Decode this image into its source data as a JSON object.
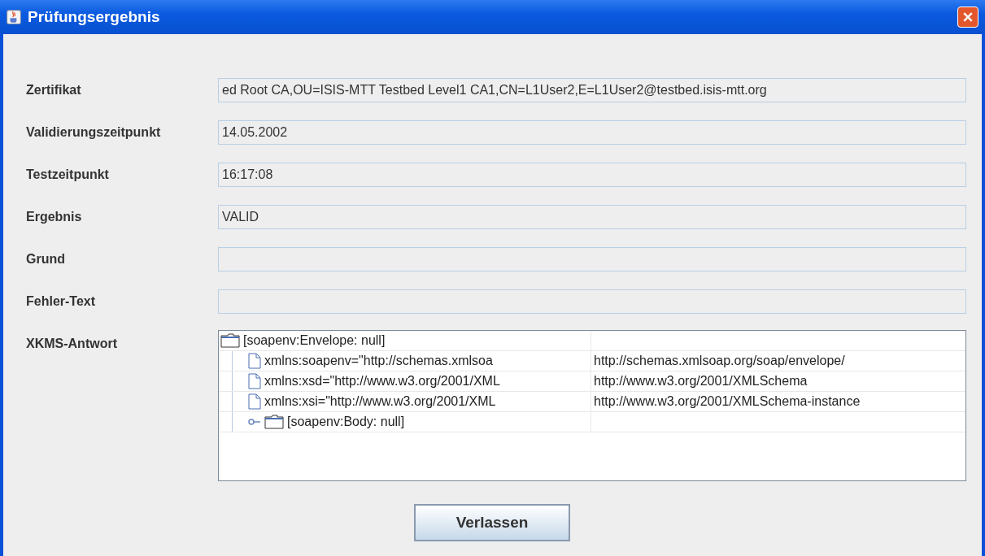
{
  "window": {
    "title": "Prüfungsergebnis"
  },
  "fields": [
    {
      "label": "Zertifikat",
      "value": "ed Root CA,OU=ISIS-MTT Testbed Level1 CA1,CN=L1User2,E=L1User2@testbed.isis-mtt.org"
    },
    {
      "label": "Validierungszeitpunkt",
      "value": "14.05.2002"
    },
    {
      "label": "Testzeitpunkt",
      "value": "16:17:08"
    },
    {
      "label": "Ergebnis",
      "value": "VALID"
    },
    {
      "label": "Grund"
    },
    {
      "label": "Fehler-Text"
    }
  ],
  "response": {
    "label": "XKMS-Antwort",
    "tree": [
      {
        "kind": "folder",
        "label": "[soapenv:Envelope: null]",
        "expanded": true,
        "children": [
          {
            "kind": "file",
            "label": "xmlns:soapenv=\"http://schemas.xmlsoa",
            "value": "http://schemas.xmlsoap.org/soap/envelope/"
          },
          {
            "kind": "file",
            "label": "xmlns:xsd=\"http://www.w3.org/2001/XML",
            "value": "http://www.w3.org/2001/XMLSchema"
          },
          {
            "kind": "file",
            "label": "xmlns:xsi=\"http://www.w3.org/2001/XML",
            "value": "http://www.w3.org/2001/XMLSchema-instance"
          },
          {
            "kind": "folder",
            "label": "[soapenv:Body: null]",
            "expanded": false
          }
        ]
      }
    ]
  },
  "buttons": [
    "Verlassen"
  ]
}
